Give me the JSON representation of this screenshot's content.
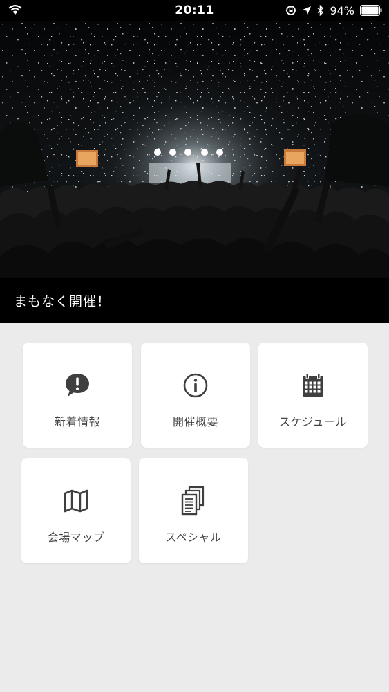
{
  "status_bar": {
    "time": "20:11",
    "battery_percent": "94%"
  },
  "hero": {
    "caption": "まもなく開催！"
  },
  "menu": {
    "items": [
      {
        "label": "新着情報",
        "icon": "chat-alert-icon"
      },
      {
        "label": "開催概要",
        "icon": "info-circle-icon"
      },
      {
        "label": "スケジュール",
        "icon": "calendar-icon"
      },
      {
        "label": "会場マップ",
        "icon": "map-icon"
      },
      {
        "label": "スペシャル",
        "icon": "documents-icon"
      }
    ]
  },
  "colors": {
    "background": "#ebebec",
    "tile": "#ffffff",
    "icon": "#3f3f3f",
    "label": "#444444"
  }
}
